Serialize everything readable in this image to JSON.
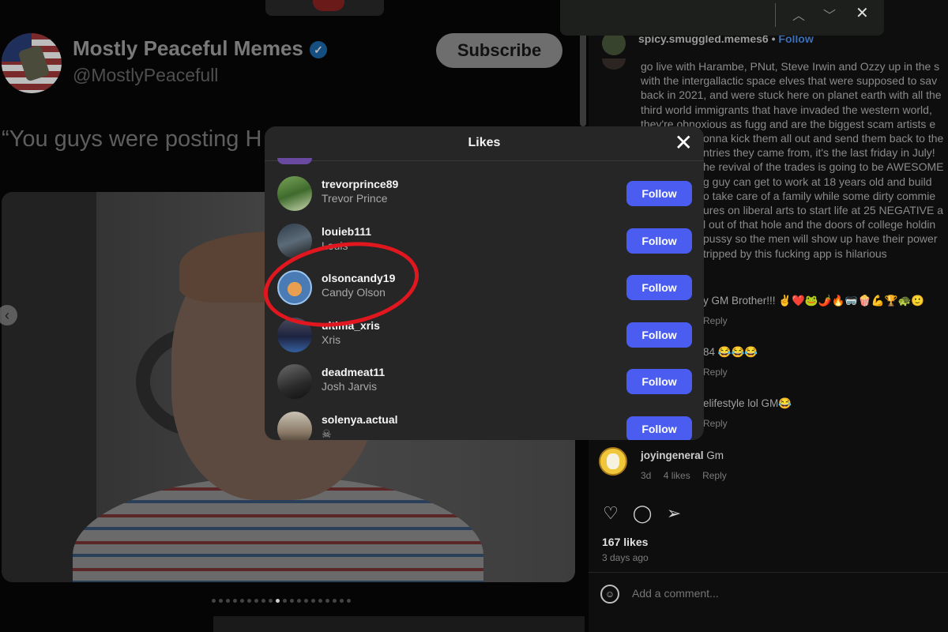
{
  "tweet": {
    "account_name": "Mostly Peaceful Memes",
    "handle": "@MostlyPeacefull",
    "subscribe_label": "Subscribe",
    "quote_text": "“You guys were posting H"
  },
  "find_bar": {
    "prev_icon": "chevron-up-icon",
    "next_icon": "chevron-down-icon",
    "close_icon": "close-icon"
  },
  "post": {
    "poster_username": "spicy.smuggled.memes6",
    "separator": "•",
    "follow_link": "Follow",
    "caption_lines": [
      "go live with Harambe, PNut, Steve Irwin and Ozzy up in the s",
      "with the intergallactic space elves that were supposed to sav",
      "back in 2021, and were stuck here on planet earth with all the",
      "third world immigrants that have invaded the western world,",
      "they're obnoxious as fugg and are the biggest scam artists e",
      "onna kick them all out and send them back to the",
      "ntries they came from, it's the last friday in July!",
      "he revival of the trades is going to be AWESOME",
      "g guy can get to work at 18 years old and build",
      "o take care of a family while some dirty commie",
      "ures on liberal arts to start life at 25 NEGATIVE a",
      "l out of that hole and the doors of college holdin",
      "pussy so the men will show up have their power",
      "tripped by this fucking app is hilarious"
    ],
    "comments": [
      {
        "text": "y GM Brother!!! ✌️❤️🐸🌶️🔥🥽🍿💪🏆🐢🙂",
        "meta": [
          "Reply"
        ]
      },
      {
        "text": "84 😂😂😂",
        "meta": [
          "Reply"
        ]
      },
      {
        "text": "elifestyle lol GM😂",
        "meta": [
          "Reply"
        ]
      },
      {
        "username": "joyingeneral",
        "text": "Gm",
        "meta": [
          "3d",
          "4 likes",
          "Reply"
        ]
      }
    ],
    "likes_count": "167 likes",
    "posted_ago": "3 days ago",
    "comment_placeholder": "Add a comment..."
  },
  "likes_modal": {
    "title": "Likes",
    "close_icon": "close-icon",
    "users": [
      {
        "username": "trevorprince89",
        "full_name": "Trevor Prince",
        "button": "Follow"
      },
      {
        "username": "louieb111",
        "full_name": "Louis",
        "button": "Follow"
      },
      {
        "username": "olsoncandy19",
        "full_name": "Candy Olson",
        "button": "Follow"
      },
      {
        "username": "ultima_xris",
        "full_name": "Xris",
        "button": "Follow"
      },
      {
        "username": "deadmeat11",
        "full_name": "Josh Jarvis",
        "button": "Follow"
      },
      {
        "username": "solenya.actual",
        "full_name": "☠",
        "button": "Follow"
      }
    ],
    "highlight_color": "#e0171f",
    "follow_button_color": "#4a5df0"
  },
  "carousel": {
    "total_slides": 20,
    "active_slide": 10
  }
}
